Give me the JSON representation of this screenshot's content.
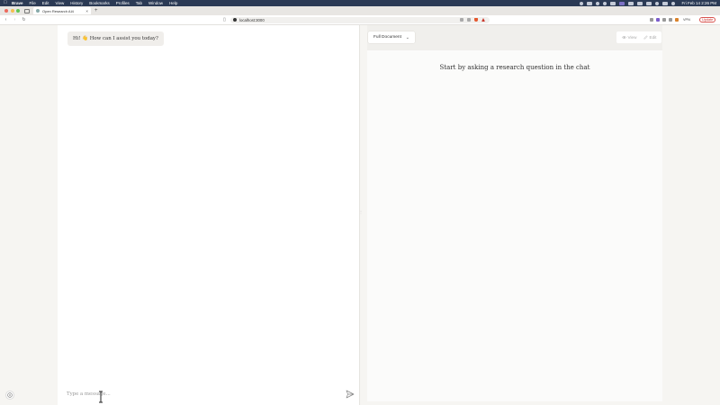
{
  "menubar": {
    "app_name": "Brave",
    "items": [
      "File",
      "Edit",
      "View",
      "History",
      "Bookmarks",
      "Profiles",
      "Tab",
      "Window",
      "Help"
    ],
    "clock": "Fri Feb 14  2:26 PM"
  },
  "browser": {
    "tab_title": "Open Research AI4",
    "url": "localhost:3000",
    "vpn_label": "VPN",
    "update_label": "Update"
  },
  "chat": {
    "greeting": "Hi! 👋 How can I assist you today?",
    "input_placeholder": "Type a message..."
  },
  "document": {
    "mode_selected": "Full Document",
    "view_label": "View",
    "edit_label": "Edit",
    "empty_message": "Start by asking a research question in the chat"
  },
  "colors": {
    "menubar_bg": "#2b3a55",
    "panel_bg": "#ffffff",
    "page_bg": "#f6f5f2"
  }
}
